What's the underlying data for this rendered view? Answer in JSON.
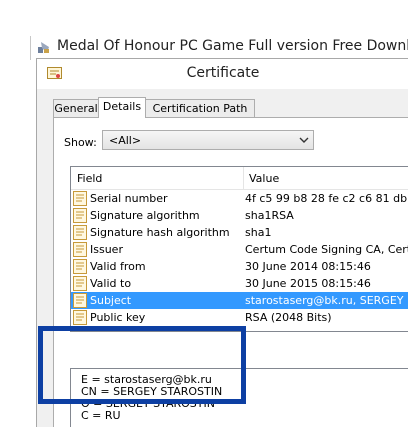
{
  "window": {
    "title": "Medal Of Honour PC Game Full version Free Downl..."
  },
  "dialog": {
    "title": "Certificate"
  },
  "tabs": [
    {
      "label": "General",
      "active": false
    },
    {
      "label": "Details",
      "active": true
    },
    {
      "label": "Certification Path",
      "active": false
    }
  ],
  "show": {
    "label": "Show:",
    "selected": "<All>"
  },
  "list": {
    "columns": {
      "field": "Field",
      "value": "Value"
    },
    "rows": [
      {
        "field": "Serial number",
        "value": "4f c5 99 b8 28 fe c2 c6 81 db ..."
      },
      {
        "field": "Signature algorithm",
        "value": "sha1RSA"
      },
      {
        "field": "Signature hash algorithm",
        "value": "sha1"
      },
      {
        "field": "Issuer",
        "value": "Certum Code Signing CA, Cert..."
      },
      {
        "field": "Valid from",
        "value": "30 June 2014 08:15:46"
      },
      {
        "field": "Valid to",
        "value": "30 June 2015 08:15:46"
      },
      {
        "field": "Subject",
        "value": "starostaserg@bk.ru, SERGEY ..."
      },
      {
        "field": "Public key",
        "value": "RSA (2048 Bits)"
      }
    ],
    "selected_index": 6
  },
  "detail": {
    "lines": [
      "E = starostaserg@bk.ru",
      "CN = SERGEY STAROSTIN",
      "O = SERGEY STAROSTIN",
      "C = RU"
    ]
  },
  "colors": {
    "selection": "#3399ff",
    "highlight_box": "#0d3fa3"
  }
}
